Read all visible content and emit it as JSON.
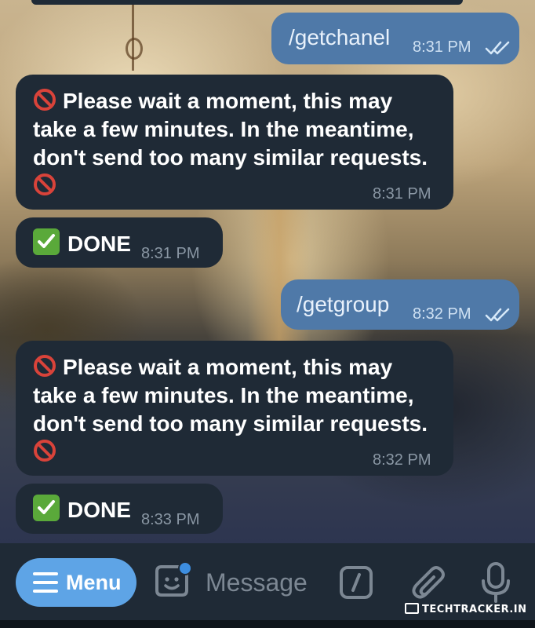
{
  "chat": {
    "messages": [
      {
        "direction": "out",
        "text": "/getchanel",
        "time": "8:31 PM",
        "status": "read"
      },
      {
        "direction": "in",
        "lines": [
          "Please wait a moment, this may",
          "take a few minutes. In the meantime,",
          "don't send too many similar requests."
        ],
        "time": "8:31 PM"
      },
      {
        "direction": "in",
        "text": "DONE",
        "time": "8:31 PM"
      },
      {
        "direction": "out",
        "text": "/getgroup",
        "time": "8:32 PM",
        "status": "read"
      },
      {
        "direction": "in",
        "lines": [
          "Please wait a moment, this may",
          "take a few minutes. In the meantime,",
          "don't send too many similar requests."
        ],
        "time": "8:32 PM"
      },
      {
        "direction": "in",
        "text": "DONE",
        "time": "8:33 PM"
      }
    ]
  },
  "composer": {
    "menu_label": "Menu",
    "placeholder": "Message"
  },
  "watermark": {
    "text": "TECHTRACKER.IN"
  },
  "icons": {
    "no_entry": "no-entry-emoji",
    "check_mark": "check-mark-button-emoji",
    "read_receipt": "double-check-icon",
    "menu": "hamburger-icon",
    "sticker": "sticker-icon",
    "commands": "slash-command-icon",
    "attach": "paperclip-icon",
    "voice": "microphone-icon"
  },
  "colors": {
    "incoming_bubble": "#1f2a36",
    "outgoing_bubble": "#4f79a8",
    "accent": "#5ea4e6",
    "bar": "#1f2a36",
    "badge": "#3d8ee0",
    "checkmark_green": "#5aa93a",
    "no_entry_red": "#d9433a"
  }
}
